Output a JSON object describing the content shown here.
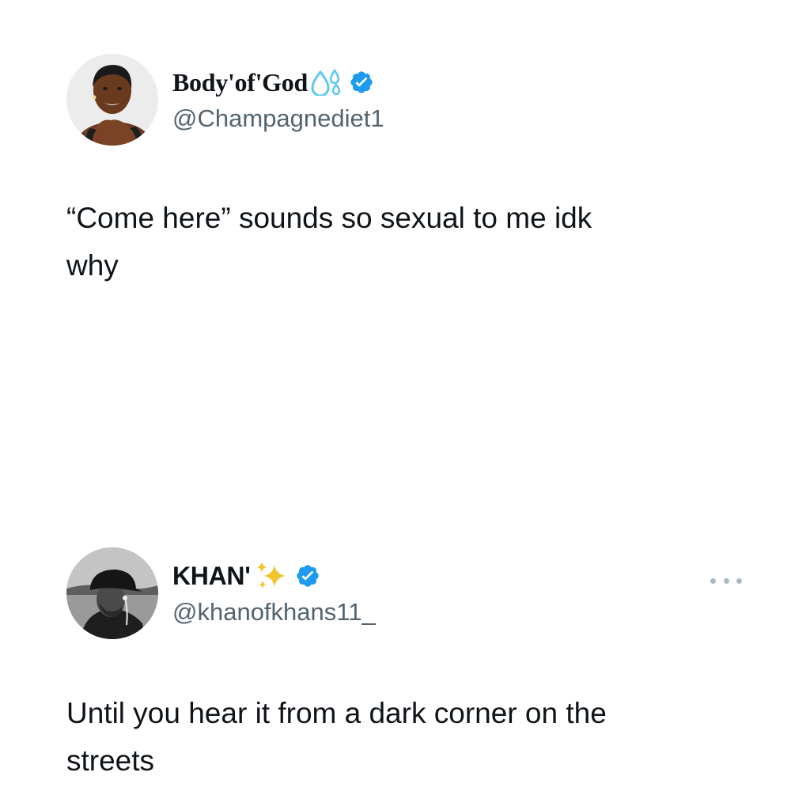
{
  "tweets": [
    {
      "display_name": "Body'of'God",
      "name_emoji": "sweat-droplets",
      "verified": true,
      "handle": "@Champagnediet1",
      "text": "“Come here” sounds so sexual to me idk\nwhy",
      "avatar": "avatar-photo"
    },
    {
      "display_name": "KHAN'",
      "name_emoji": "sparkles",
      "verified": true,
      "handle": "@khanofkhans11_",
      "text": "Until you hear it from a dark corner on the\nstreets",
      "avatar": "avatar-photo",
      "menu_icon": "more-options-icon"
    }
  ],
  "colors": {
    "verified": "#1d9bf0",
    "handle": "#536471",
    "text": "#0f1419",
    "sparkle": "#f4c430",
    "droplet": "#5cc8f2"
  }
}
